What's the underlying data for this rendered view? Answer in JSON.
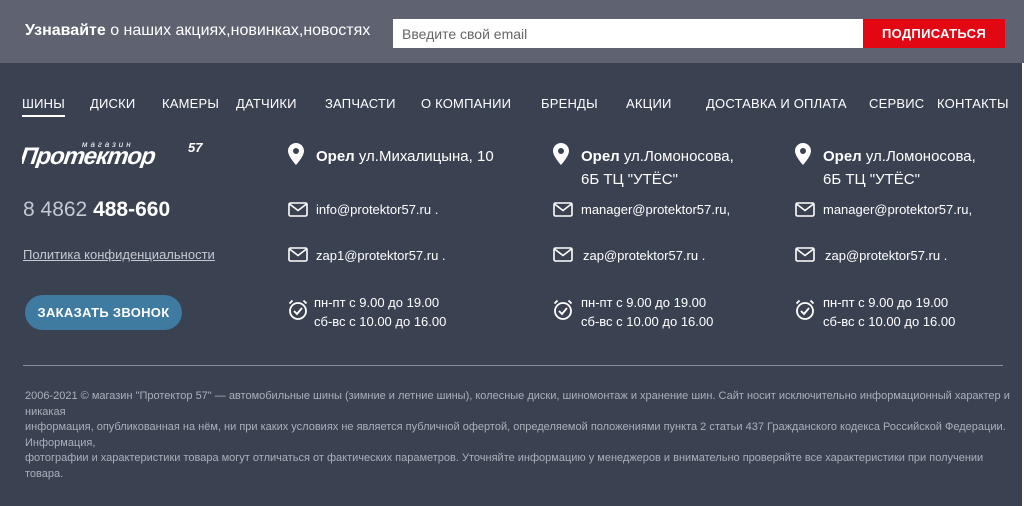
{
  "subscribe": {
    "text_bold": "Узнавайте",
    "text_rest": " о наших акциях,новинках,новостях",
    "placeholder": "Введите свой email",
    "button": "ПОДПИСАТЬСЯ"
  },
  "nav": [
    "ШИНЫ",
    "ДИСКИ",
    "КАМЕРЫ",
    "ДАТЧИКИ",
    "ЗАПЧАСТИ",
    "О КОМПАНИИ",
    "БРЕНДЫ",
    "АКЦИИ",
    "ДОСТАВКА И ОПЛАТА",
    "СЕРВИС",
    "КОНТАКТЫ"
  ],
  "brand": {
    "logo_small": "магазин",
    "logo_main": "Протектор",
    "logo_num": "57"
  },
  "phone": {
    "prefix": "8 4862 ",
    "number": "488-660"
  },
  "privacy": "Политика конфиденциальности",
  "callback": "ЗАКАЗАТЬ ЗВОНОК",
  "offices": [
    {
      "city": "Орел",
      "address_line1": " ул.Михалицына, 10",
      "address_line2": "",
      "email1": "info@protektor57.ru .",
      "email2": "zap1@protektor57.ru .",
      "hours1": "пн-пт с 9.00 до 19.00",
      "hours2": "сб-вс с 10.00 до 16.00"
    },
    {
      "city": "Орел",
      "address_line1": " ул.Ломоносова,",
      "address_line2": "6Б ТЦ \"УТЁС\"",
      "email1": "manager@protektor57.ru,",
      "email2": "zap@protektor57.ru .",
      "hours1": "пн-пт с 9.00 до 19.00",
      "hours2": "сб-вс с 10.00 до 16.00"
    },
    {
      "city": "Орел",
      "address_line1": " ул.Ломоносова,",
      "address_line2": "6Б ТЦ \"УТЁС\"",
      "email1": "manager@protektor57.ru,",
      "email2": "zap@protektor57.ru .",
      "hours1": "пн-пт с 9.00 до 19.00",
      "hours2": "сб-вс с 10.00 до 16.00"
    }
  ],
  "copyright": [
    "2006-2021 © магазин \"Протектор 57\" — автомобильные шины (зимние и летние шины), колесные диски, шиномонтаж и хранение шин. Сайт носит исключительно информационный характер и никакая",
    "информация, опубликованная на нём, ни при каких условиях не является публичной офертой, определяемой положениями пункта 2 статьи 437 Гражданского кодекса Российской Федерации. Информация,",
    "фотографии и характеристики товара могут отличаться от фактических параметров. Уточняйте информацию у менеджеров и внимательно проверяйте все характеристики при получении товара."
  ],
  "colors": {
    "accent_red": "#e30613",
    "callback_blue": "#3f7aa0",
    "footer_bg": "#3a4252",
    "subscribe_bg": "#5f6270"
  }
}
